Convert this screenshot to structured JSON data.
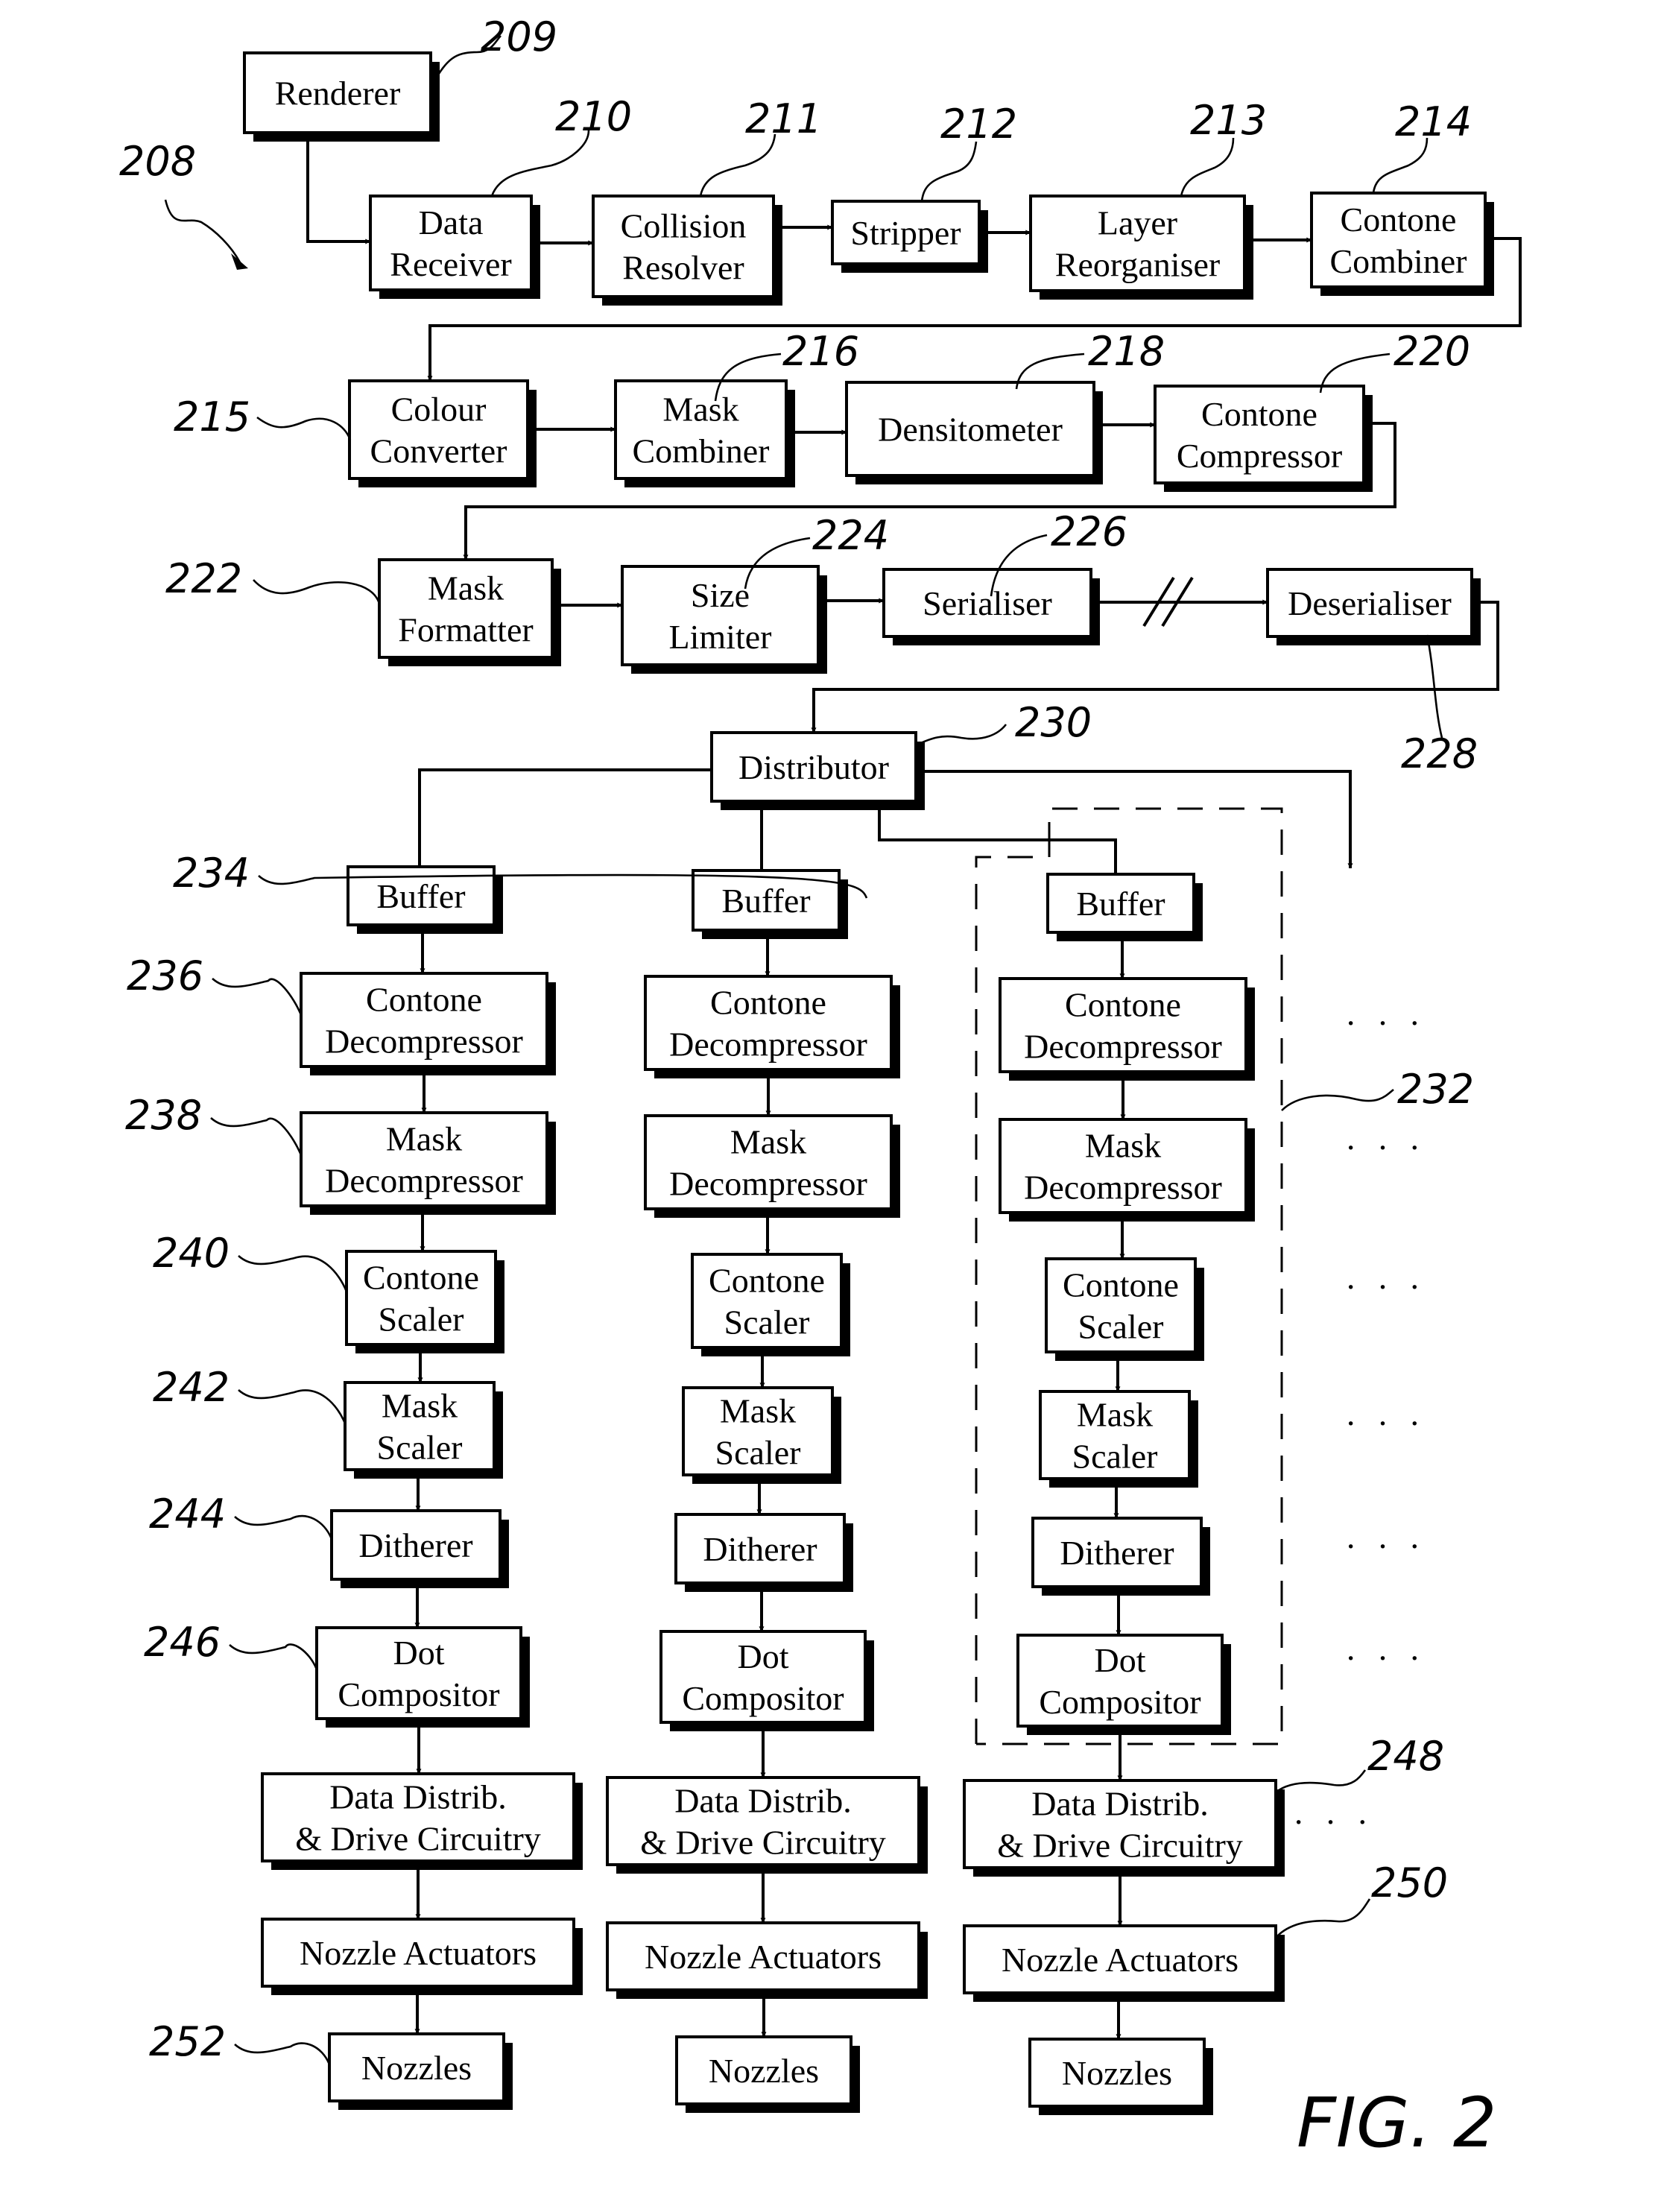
{
  "figure": {
    "label": "FIG. 2",
    "system_ref": "208"
  },
  "pipeline": {
    "renderer": {
      "lines": [
        "Renderer"
      ],
      "ref": "209"
    },
    "data_receiver": {
      "lines": [
        "Data",
        "Receiver"
      ],
      "ref": "210"
    },
    "collision_resolver": {
      "lines": [
        "Collision",
        "Resolver"
      ],
      "ref": "211"
    },
    "stripper": {
      "lines": [
        "Stripper"
      ],
      "ref": "212"
    },
    "layer_reorganiser": {
      "lines": [
        "Layer",
        "Reorganiser"
      ],
      "ref": "213"
    },
    "contone_combiner": {
      "lines": [
        "Contone",
        "Combiner"
      ],
      "ref": "214"
    },
    "colour_converter": {
      "lines": [
        "Colour",
        "Converter"
      ],
      "ref": "215"
    },
    "mask_combiner": {
      "lines": [
        "Mask",
        "Combiner"
      ],
      "ref": "216"
    },
    "densitometer": {
      "lines": [
        "Densitometer"
      ],
      "ref": "218"
    },
    "contone_compressor": {
      "lines": [
        "Contone",
        "Compressor"
      ],
      "ref": "220"
    },
    "mask_formatter": {
      "lines": [
        "Mask",
        "Formatter"
      ],
      "ref": "222"
    },
    "size_limiter": {
      "lines": [
        "Size",
        "Limiter"
      ],
      "ref": "224"
    },
    "serialiser": {
      "lines": [
        "Serialiser"
      ],
      "ref": "226"
    },
    "deserialiser": {
      "lines": [
        "Deserialiser"
      ],
      "ref": "228"
    },
    "distributor": {
      "lines": [
        "Distributor"
      ],
      "ref": "230"
    }
  },
  "channel": {
    "group_ref": "232",
    "stages": [
      {
        "key": "buffer",
        "lines": [
          "Buffer"
        ],
        "ref": "234"
      },
      {
        "key": "contone_decompressor",
        "lines": [
          "Contone",
          "Decompressor"
        ],
        "ref": "236"
      },
      {
        "key": "mask_decompressor",
        "lines": [
          "Mask",
          "Decompressor"
        ],
        "ref": "238"
      },
      {
        "key": "contone_scaler",
        "lines": [
          "Contone",
          "Scaler"
        ],
        "ref": "240"
      },
      {
        "key": "mask_scaler",
        "lines": [
          "Mask",
          "Scaler"
        ],
        "ref": "242"
      },
      {
        "key": "ditherer",
        "lines": [
          "Ditherer"
        ],
        "ref": "244"
      },
      {
        "key": "dot_compositor",
        "lines": [
          "Dot",
          "Compositor"
        ],
        "ref": "246"
      },
      {
        "key": "data_distrib",
        "lines": [
          "Data Distrib.",
          "& Drive Circuitry"
        ],
        "ref": "248"
      },
      {
        "key": "nozzle_actuators",
        "lines": [
          "Nozzle Actuators"
        ],
        "ref": "250"
      },
      {
        "key": "nozzles",
        "lines": [
          "Nozzles"
        ],
        "ref": "252"
      }
    ],
    "column_count": 3,
    "continuation": "· · ·"
  }
}
